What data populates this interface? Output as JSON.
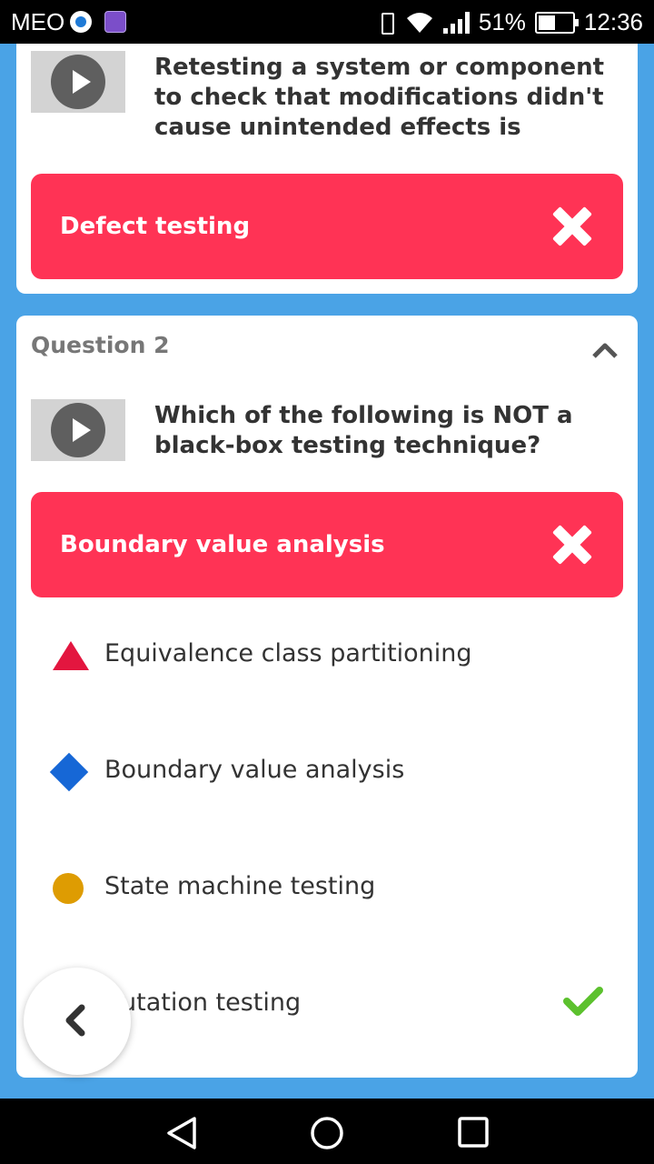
{
  "status_bar": {
    "carrier": "MEO",
    "battery_percent": "51%",
    "time": "12:36"
  },
  "question1": {
    "text": "Retesting a system or component to check that modifications didn't cause unintended effects is",
    "selected_answer": "Defect testing"
  },
  "question2": {
    "title": "Question 2",
    "text": "Which of the following is NOT a black-box testing technique?",
    "selected_answer": "Boundary value analysis",
    "options": [
      {
        "shape": "triangle",
        "color": "#e3163f",
        "label": "Equivalence class partitioning"
      },
      {
        "shape": "diamond",
        "color": "#1667d6",
        "label": "Boundary value analysis"
      },
      {
        "shape": "circle",
        "color": "#de9c02",
        "label": "State machine testing"
      },
      {
        "shape": "square",
        "label": "utation testing",
        "correct": true
      }
    ]
  },
  "icons": {
    "play": "play-icon",
    "wrong": "x-mark-icon",
    "correct": "checkmark-icon",
    "collapse": "chevron-up-icon",
    "back": "chevron-left-icon"
  },
  "colors": {
    "background": "#4aa3e6",
    "wrong_answer": "#ff3355",
    "correct_check": "#5cc12e"
  }
}
